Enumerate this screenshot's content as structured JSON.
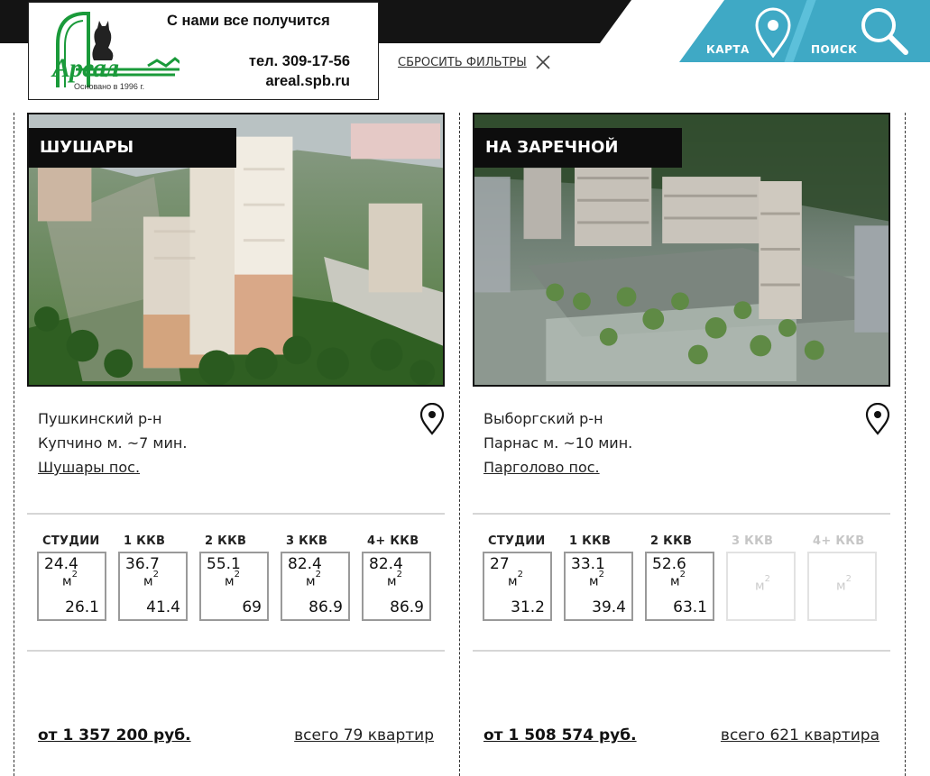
{
  "header": {
    "slogan": "С нами все получится",
    "phone": "тел. 309-17-56",
    "site": "areal.spb.ru",
    "founded": "Основано в 1996 г.",
    "logo_word": "Ареал",
    "reset_filters": "СБРОСИТЬ ФИЛЬТРЫ",
    "nav_map": "КАРТА",
    "nav_search": "ПОИСК"
  },
  "colors": {
    "accent": "#3fa9c5",
    "logo_green": "#1a9a3a",
    "dark": "#141414"
  },
  "cards": [
    {
      "title": "ШУШАРЫ",
      "district": "Пушкинский р-н",
      "metro": "Купчино м. ~7 мин.",
      "locality": "Шушары пос.",
      "rooms": [
        {
          "label": "СТУДИИ",
          "min": "24.4",
          "unit": "м",
          "sup": "2",
          "max": "26.1"
        },
        {
          "label": "1 ККВ",
          "min": "36.7",
          "unit": "м",
          "sup": "2",
          "max": "41.4"
        },
        {
          "label": "2 ККВ",
          "min": "55.1",
          "unit": "м",
          "sup": "2",
          "max": "69"
        },
        {
          "label": "3 ККВ",
          "min": "82.4",
          "unit": "м",
          "sup": "2",
          "max": "86.9"
        },
        {
          "label": "4+ ККВ",
          "min": "82.4",
          "unit": "м",
          "sup": "2",
          "max": "86.9"
        }
      ],
      "price": "от 1 357 200 руб.",
      "total": "всего 79 квартир"
    },
    {
      "title": "НА ЗАРЕЧНОЙ",
      "district": "Выборгский р-н",
      "metro": "Парнас м. ~10 мин.",
      "locality": "Парголово пос.",
      "rooms": [
        {
          "label": "СТУДИИ",
          "min": "27",
          "unit": "м",
          "sup": "2",
          "max": "31.2"
        },
        {
          "label": "1 ККВ",
          "min": "33.1",
          "unit": "м",
          "sup": "2",
          "max": "39.4"
        },
        {
          "label": "2 ККВ",
          "min": "52.6",
          "unit": "м",
          "sup": "2",
          "max": "63.1"
        },
        {
          "label": "3 ККВ",
          "unit": "м",
          "sup": "2"
        },
        {
          "label": "4+ ККВ",
          "unit": "м",
          "sup": "2"
        }
      ],
      "price": "от 1 508 574 руб.",
      "total": "всего 621 квартира"
    }
  ]
}
